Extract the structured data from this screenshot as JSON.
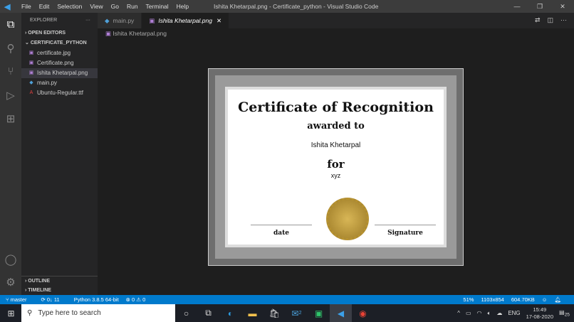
{
  "titlebar": {
    "menu": [
      "File",
      "Edit",
      "Selection",
      "View",
      "Go",
      "Run",
      "Terminal",
      "Help"
    ],
    "title": "Ishita Khetarpal.png - Certificate_python - Visual Studio Code"
  },
  "sidebar": {
    "header": "EXPLORER",
    "open_editors": "OPEN EDITORS",
    "folder": "CERTIFICATE_PYTHON",
    "files": [
      {
        "name": "certificate.jpg",
        "icon": "image-icon"
      },
      {
        "name": "Certificate.png",
        "icon": "image-icon"
      },
      {
        "name": "Ishita Khetarpal.png",
        "icon": "image-icon"
      },
      {
        "name": "main.py",
        "icon": "python-icon"
      },
      {
        "name": "Ubuntu-Regular.ttf",
        "icon": "font-icon"
      }
    ],
    "outline": "OUTLINE",
    "timeline": "TIMELINE"
  },
  "tabs": [
    {
      "label": "main.py"
    },
    {
      "label": "Ishita Khetarpal.png"
    }
  ],
  "breadcrumb": "Ishita Khetarpal.png",
  "certificate": {
    "title": "Certificate of Recognition",
    "awarded": "awarded to",
    "name": "Ishita Khetarpal",
    "for": "for",
    "reason": "xyz",
    "date": "date",
    "signature": "Signature"
  },
  "status": {
    "branch": "master",
    "sync": "0↓ 11",
    "python": "Python 3.8.5 64-bit",
    "problems": "⊗ 0 ⚠ 0",
    "zoom": "51%",
    "dims": "1103x854",
    "size": "604.70KB"
  },
  "taskbar": {
    "search": "Type here to search",
    "lang": "ENG",
    "time": "15:49",
    "date": "17-08-2020",
    "notif": "25",
    "mail_badge": "2"
  }
}
